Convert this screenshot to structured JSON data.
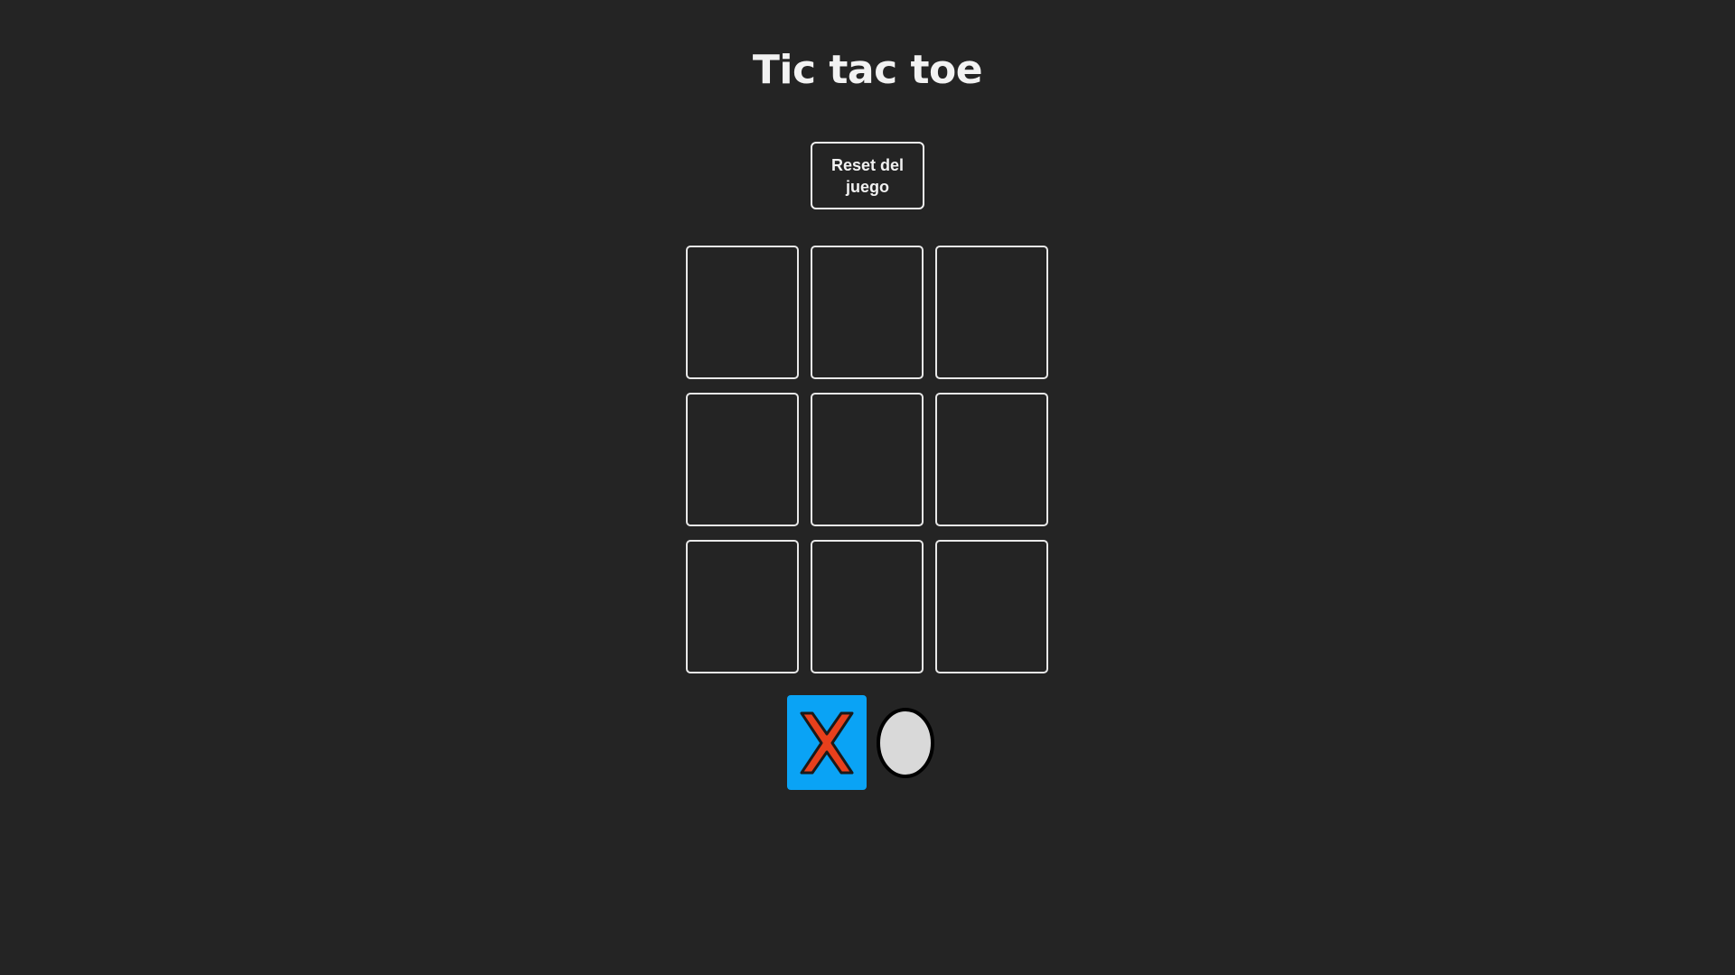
{
  "game": {
    "title": "Tic tac toe",
    "reset_label": "Reset del juego",
    "board": [
      "",
      "",
      "",
      "",
      "",
      "",
      "",
      "",
      ""
    ],
    "current_turn": "X"
  },
  "colors": {
    "background": "#242424",
    "active_player_bg": "#0aa3f5",
    "x_mark": "#e8401c",
    "o_mark": "#d9d9d9"
  },
  "icons": {
    "player_x": "x-mark-icon",
    "player_o": "circle-mark-icon"
  }
}
